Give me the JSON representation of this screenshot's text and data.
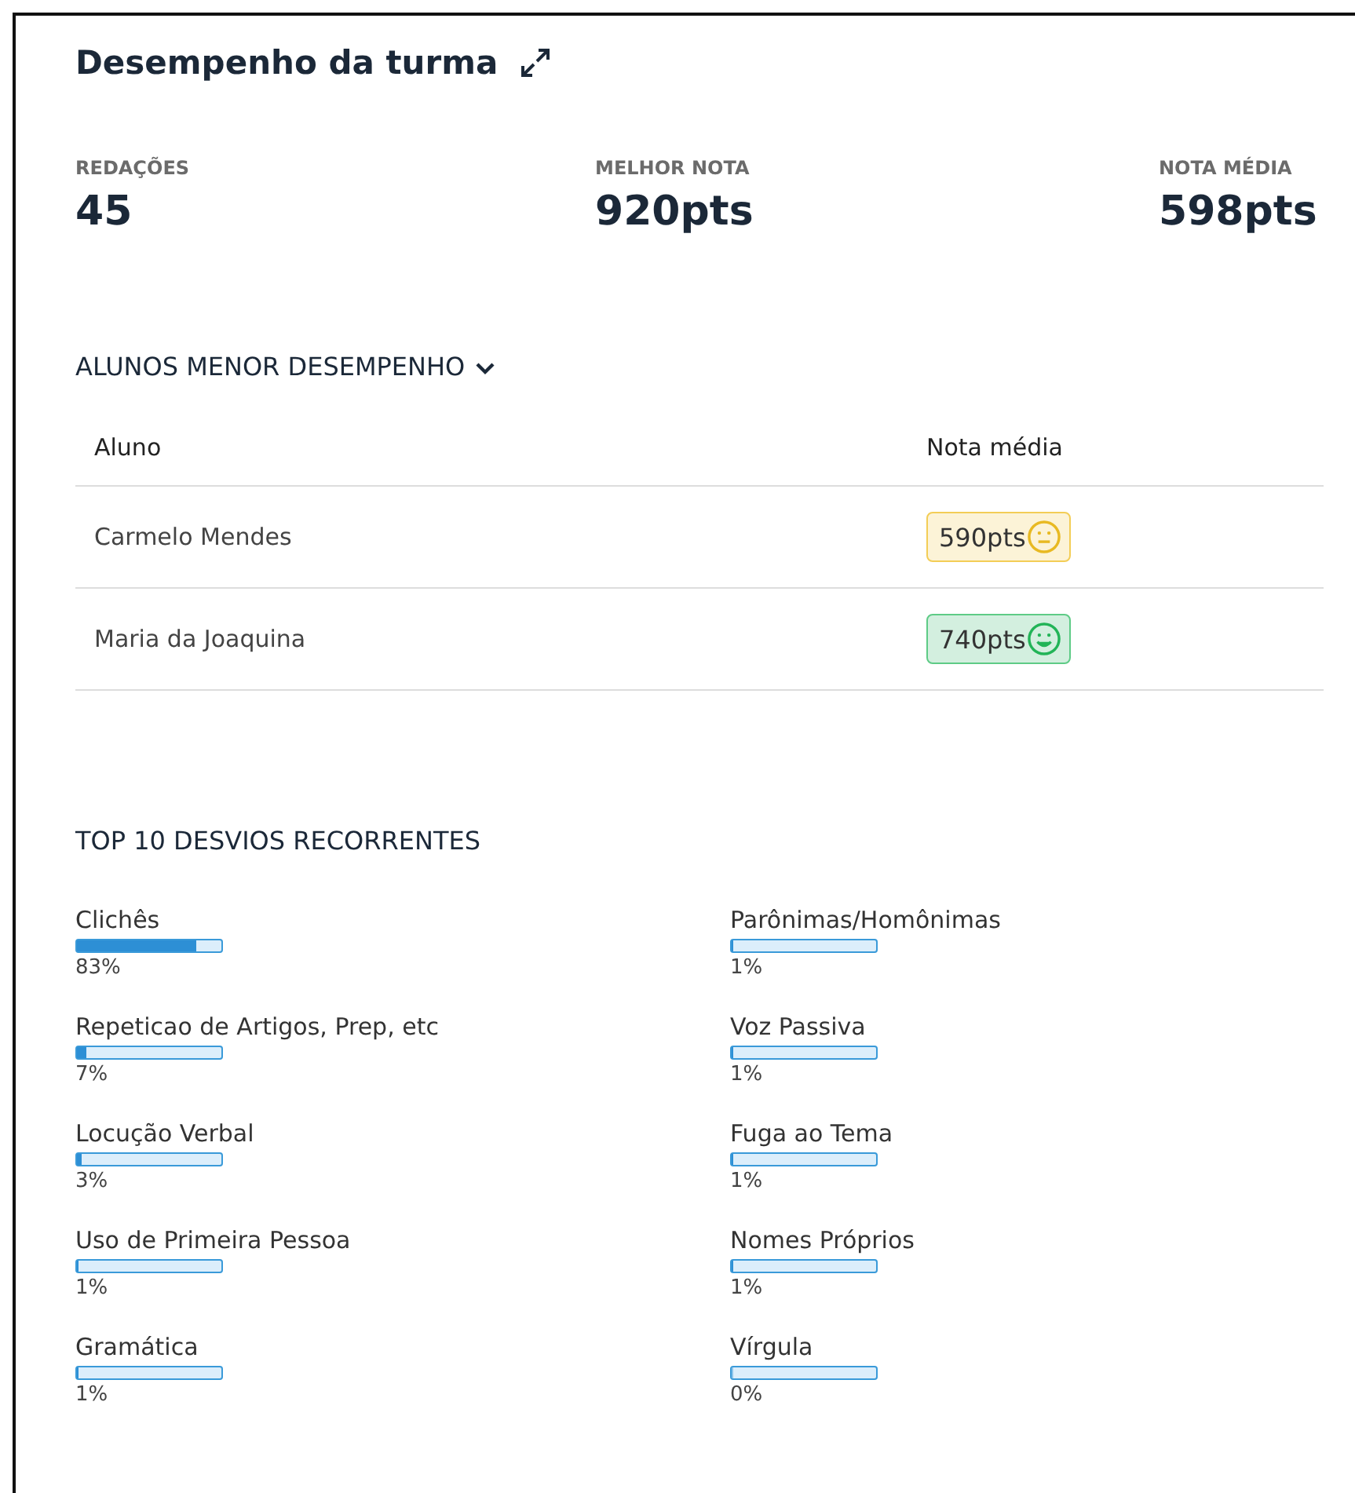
{
  "panel": {
    "title": "Desempenho da turma"
  },
  "stats": [
    {
      "label": "REDAÇÕES",
      "value": "45"
    },
    {
      "label": "MELHOR NOTA",
      "value": "920pts"
    },
    {
      "label": "NOTA MÉDIA",
      "value": "598pts"
    }
  ],
  "low_students": {
    "title": "ALUNOS MENOR DESEMPENHO",
    "expanded": true,
    "columns": [
      "Aluno",
      "Nota média"
    ],
    "rows": [
      {
        "name": "Carmelo Mendes",
        "score": "590pts",
        "kind": "neutral"
      },
      {
        "name": "Maria da Joaquina",
        "score": "740pts",
        "kind": "happy"
      }
    ]
  },
  "deviations": {
    "title": "TOP 10 DESVIOS RECORRENTES",
    "items": [
      {
        "label": "Clichês",
        "level": 0.83,
        "percent": "83%"
      },
      {
        "label": "Repeticao de Artigos, Prep, etc",
        "level": 0.07,
        "percent": "7%"
      },
      {
        "label": "Locução Verbal",
        "level": 0.03,
        "percent": "3%"
      },
      {
        "label": "Uso de Primeira Pessoa",
        "level": 0.01,
        "percent": "1%"
      },
      {
        "label": "Gramática",
        "level": 0.01,
        "percent": "1%"
      },
      {
        "label": "Parônimas/Homônimas",
        "level": 0.01,
        "percent": "1%"
      },
      {
        "label": "Voz Passiva",
        "level": 0.01,
        "percent": "1%"
      },
      {
        "label": "Fuga ao Tema",
        "level": 0.01,
        "percent": "1%"
      },
      {
        "label": "Nomes Próprios",
        "level": 0.01,
        "percent": "1%"
      },
      {
        "label": "Vírgula",
        "level": 0,
        "percent": "0%"
      }
    ]
  }
}
